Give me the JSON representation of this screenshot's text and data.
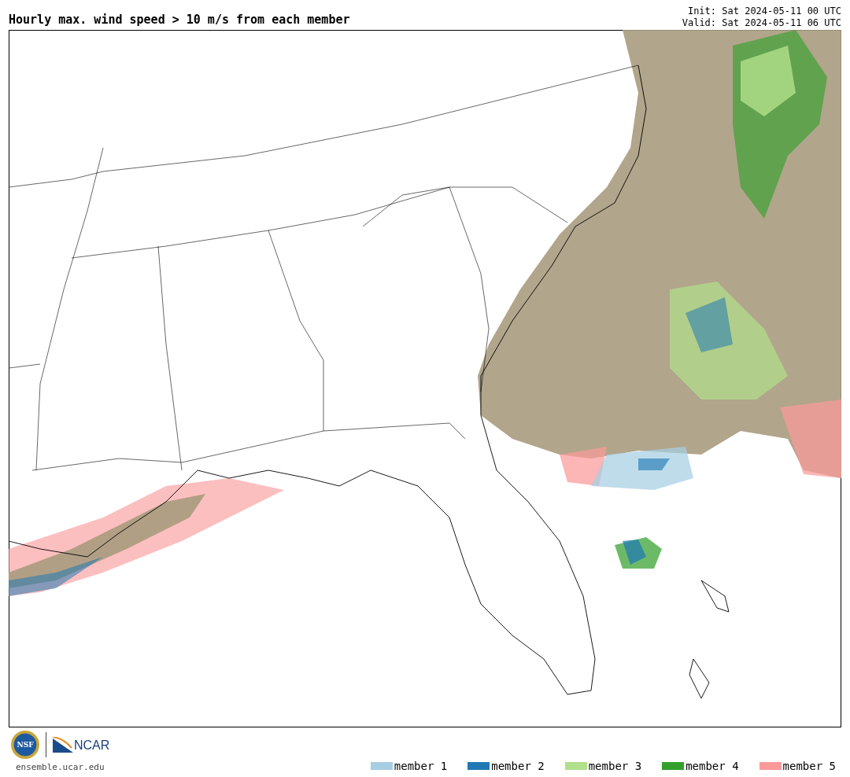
{
  "header": {
    "title": "Hourly max. wind speed > 10 m/s from each member",
    "init": "Init: Sat 2024-05-11 00 UTC",
    "valid": "Valid: Sat 2024-05-11 06 UTC"
  },
  "footer": {
    "nsf_logo_text": "NSF",
    "ncar_logo_text": "NCAR",
    "site": "ensemble.ucar.edu"
  },
  "legend": [
    {
      "label": "member 1",
      "color": "#a6cee3"
    },
    {
      "label": "member 2",
      "color": "#1f78b4"
    },
    {
      "label": "member 3",
      "color": "#b2df8a"
    },
    {
      "label": "member 4",
      "color": "#33a02c"
    },
    {
      "label": "member 5",
      "color": "#fb9a99"
    }
  ]
}
